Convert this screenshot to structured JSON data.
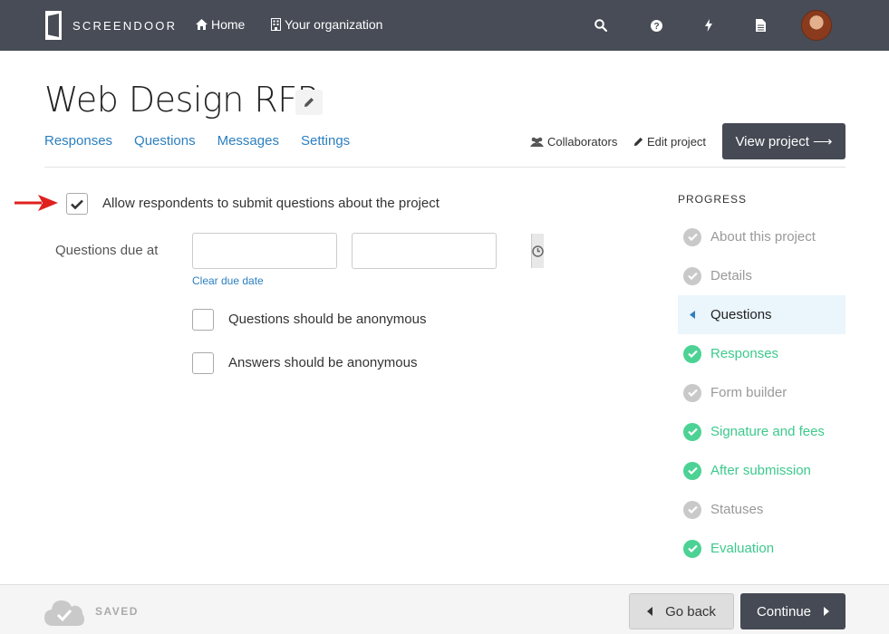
{
  "app": {
    "brand": "SCREENDOOR"
  },
  "topnav": {
    "home_label": "Home",
    "org_label": "Your organization",
    "icons": [
      "search-icon",
      "help-icon",
      "lightning-icon",
      "document-icon"
    ]
  },
  "header": {
    "title": "Web Design RFP",
    "tabs": [
      {
        "label": "Responses"
      },
      {
        "label": "Questions"
      },
      {
        "label": "Messages"
      },
      {
        "label": "Settings"
      }
    ],
    "collaborators_label": "Collaborators",
    "edit_project_label": "Edit project",
    "view_project_label": "View project ⟶"
  },
  "form": {
    "allow_questions_label": "Allow respondents to submit questions about the project",
    "allow_questions_checked": true,
    "due_label": "Questions due at",
    "date_value": "",
    "time_value": "",
    "clear_due_label": "Clear due date",
    "anon_questions_label": "Questions should be anonymous",
    "anon_questions_checked": false,
    "anon_answers_label": "Answers should be anonymous",
    "anon_answers_checked": false
  },
  "progress": {
    "title": "PROGRESS",
    "steps": [
      {
        "label": "About this project",
        "status": "pending"
      },
      {
        "label": "Details",
        "status": "pending"
      },
      {
        "label": "Questions",
        "status": "current"
      },
      {
        "label": "Responses",
        "status": "done"
      },
      {
        "label": "Form builder",
        "status": "pending"
      },
      {
        "label": "Signature and fees",
        "status": "done"
      },
      {
        "label": "After submission",
        "status": "done"
      },
      {
        "label": "Statuses",
        "status": "pending"
      },
      {
        "label": "Evaluation",
        "status": "done"
      }
    ]
  },
  "footer": {
    "saved_label": "SAVED",
    "back_label": "Go back",
    "continue_label": "Continue"
  },
  "colors": {
    "topbar": "#474c56",
    "link": "#2b7fbf",
    "done": "#4cd294",
    "pending": "#c9c9c9",
    "annotation_arrow": "#e0201e"
  }
}
